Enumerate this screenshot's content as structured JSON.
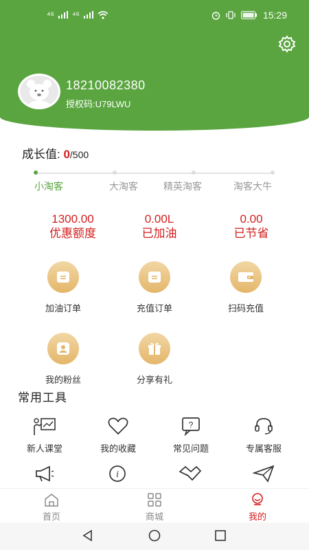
{
  "status": {
    "time": "15:29",
    "signal1": "⁴⁶",
    "signal2": "⁴⁶"
  },
  "profile": {
    "phone": "18210082380",
    "auth_code": "授权码:U79LWU"
  },
  "growth": {
    "label": "成长值: ",
    "current": "0",
    "max": "/500"
  },
  "levels": [
    {
      "label": "小淘客",
      "active": true
    },
    {
      "label": "大淘客",
      "active": false
    },
    {
      "label": "精英淘客",
      "active": false
    },
    {
      "label": "淘客大牛",
      "active": false
    }
  ],
  "stats": [
    {
      "value": "1300.00",
      "label": "优惠额度"
    },
    {
      "value": "0.00L",
      "label": "已加油"
    },
    {
      "value": "0.00",
      "label": "已节省"
    }
  ],
  "functions": [
    {
      "label": "加油订单",
      "icon": "card-icon"
    },
    {
      "label": "充值订单",
      "icon": "card-icon"
    },
    {
      "label": "扫码充值",
      "icon": "wallet-icon"
    },
    {
      "label": "我的粉丝",
      "icon": "user-icon"
    },
    {
      "label": "分享有礼",
      "icon": "gift-icon"
    }
  ],
  "tools_title": "常用工具",
  "tools": [
    {
      "label": "新人课堂",
      "icon": "classroom-icon"
    },
    {
      "label": "我的收藏",
      "icon": "heart-icon"
    },
    {
      "label": "常见问题",
      "icon": "question-icon"
    },
    {
      "label": "专属客服",
      "icon": "headset-icon"
    }
  ],
  "tools_row2_icons": [
    "megaphone-icon",
    "info-icon",
    "handshake-icon",
    "paper-plane-icon"
  ],
  "tabbar": [
    {
      "label": "首页",
      "active": false
    },
    {
      "label": "商城",
      "active": false
    },
    {
      "label": "我的",
      "active": true
    }
  ],
  "colors": {
    "brand_green": "#5aa540",
    "accent_red": "#d31d1d",
    "gold": "#e4b66a"
  }
}
